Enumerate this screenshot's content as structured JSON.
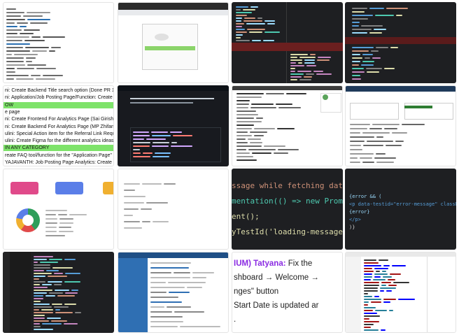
{
  "tile_text": {
    "t4_lines": [
      "ni: Create Backend Title search option (Done PR 1180 and P",
      "ni: Application/Job Posting Page/Function: Create \"use both",
      "OW",
      "e page",
      "ni: Create Frontend For Analytics Page (Sai Girish)",
      "ni: Create Backend For Analytics Page (MP Zhifan)",
      "ulini: Special Action item for the Referral Link Requirement (V",
      "ulini: Create Figma for the different analytics ideas added ab",
      " IN ANY CATEGORY",
      "reate FAQ tool/function for the \"Application Page\" (DONE an",
      "YAJAVANTH: Job Posting Page Analytics: Create a bar gr"
    ],
    "t10_lines": [
      "ssage while fetching data', (",
      "mentation(() => new Promise",
      "ent();",
      "yTestId('loading-message'))"
    ],
    "t11_lines": [
      "{error && (",
      "  <p data-testid=\"error-message\" className=\"error",
      "    {error}",
      "  </p>",
      ")}"
    ],
    "t14_label": "IUM) Tatyana:",
    "t14_rest": " Fix the",
    "t14_lines": [
      "shboard → Welcome →",
      "nges\" button",
      "Start Date is updated ar",
      "."
    ]
  },
  "colors": {
    "accent_green": "#7ee36a",
    "purple": "#8a2be2",
    "code_blue": "#569cd6",
    "code_orange": "#ce9178",
    "code_yellow": "#dcdcaa",
    "code_cyan": "#4ec9b0"
  }
}
